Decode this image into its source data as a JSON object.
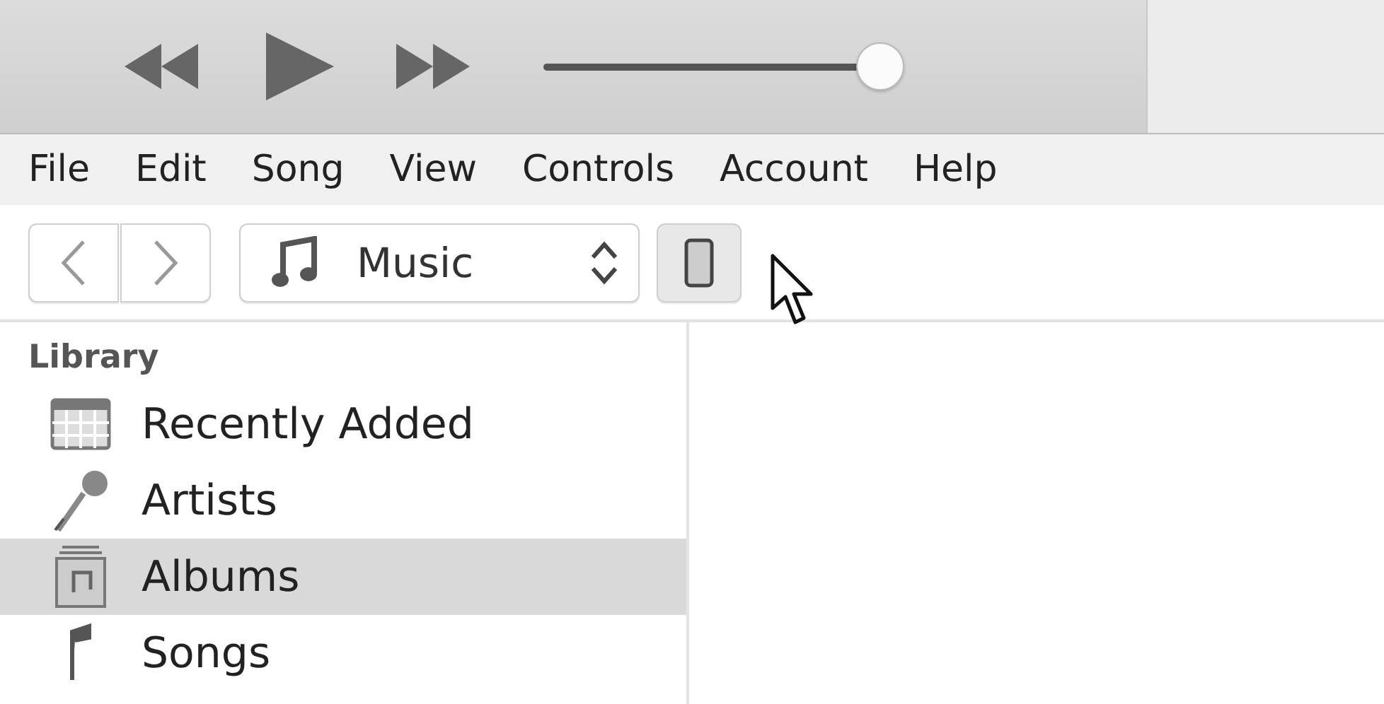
{
  "player": {
    "volume": {
      "level": 0.95
    }
  },
  "menu": [
    "File",
    "Edit",
    "Song",
    "View",
    "Controls",
    "Account",
    "Help"
  ],
  "toolbar": {
    "media_selector": "Music"
  },
  "sidebar": {
    "section": "Library",
    "items": [
      {
        "label": "Recently Added",
        "kind": "grid",
        "selected": false
      },
      {
        "label": "Artists",
        "kind": "mic",
        "selected": false
      },
      {
        "label": "Albums",
        "kind": "album",
        "selected": true
      },
      {
        "label": "Songs",
        "kind": "note",
        "selected": false
      }
    ]
  }
}
